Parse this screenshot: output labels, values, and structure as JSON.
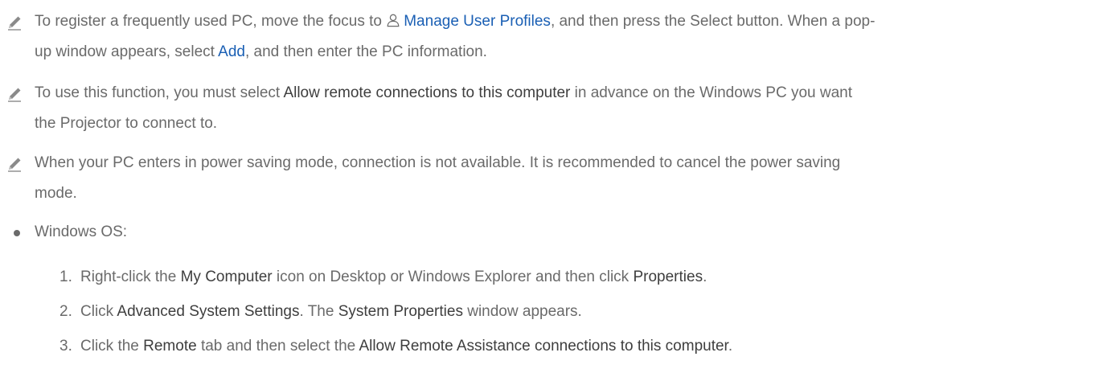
{
  "notes": [
    {
      "icon": "pencil-note-icon",
      "line1_pre": "To register a frequently used PC, move the focus to ",
      "line1_link": "Manage User Profiles",
      "line1_post": ", and then press the Select button. When a pop-",
      "line2_pre": "up window appears, select ",
      "line2_link": "Add",
      "line2_post": ", and then enter the PC information."
    },
    {
      "icon": "pencil-note-icon",
      "line1_pre": "To use this function, you must select ",
      "line1_strong": "Allow remote connections to this computer",
      "line1_post": " in advance on the Windows PC you want",
      "line2": "the Projector to connect to."
    },
    {
      "icon": "pencil-note-icon",
      "line1": "When your PC enters in power saving mode, connection is not available. It is recommended to cancel the power saving",
      "line2": "mode."
    }
  ],
  "bullet": {
    "label": "Windows OS:"
  },
  "steps": [
    {
      "num": "1.",
      "a": "Right-click the ",
      "b": "My Computer",
      "c": " icon on Desktop or Windows Explorer and then click ",
      "d": "Properties",
      "e": "."
    },
    {
      "num": "2.",
      "a": "Click ",
      "b": "Advanced System Settings",
      "c": ". The ",
      "d": "System Properties",
      "e": " window appears."
    },
    {
      "num": "3.",
      "a": "Click the ",
      "b": "Remote",
      "c": " tab and then select the ",
      "d": "Allow Remote Assistance connections to this computer",
      "e": "."
    }
  ],
  "colors": {
    "text": "#6a6a6a",
    "strong": "#3e3e3e",
    "link": "#1a5fb4"
  }
}
